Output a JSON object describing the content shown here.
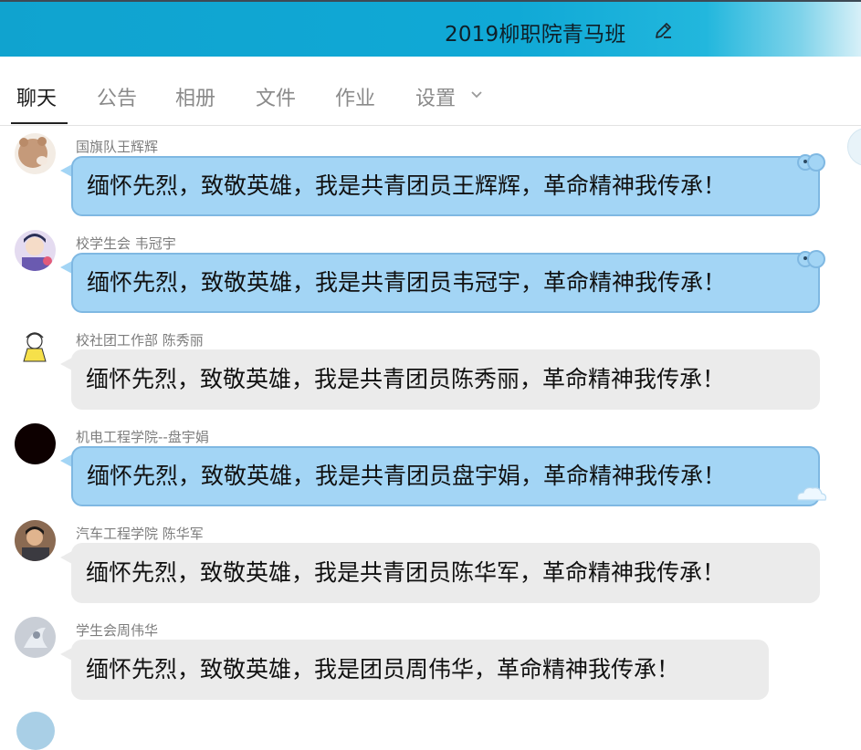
{
  "header": {
    "title": "2019柳职院青马班",
    "edit_icon": "edit-pencil-icon"
  },
  "tabs": [
    {
      "label": "聊天",
      "active": true
    },
    {
      "label": "公告"
    },
    {
      "label": "相册"
    },
    {
      "label": "文件"
    },
    {
      "label": "作业"
    },
    {
      "label": "设置"
    }
  ],
  "colors": {
    "header_bg": "#10a9d6",
    "bubble_blue": "#a3d5f5",
    "bubble_blue_border": "#7fb8e2",
    "bubble_gray": "#ebebeb"
  },
  "messages": [
    {
      "sender": "国旗队王辉辉",
      "text": "缅怀先烈，致敬英雄，我是共青团员王辉辉，革命精神我传承！",
      "style": "blue"
    },
    {
      "sender": "校学生会 韦冠宇",
      "text": "缅怀先烈，致敬英雄，我是共青团员韦冠宇，革命精神我传承！",
      "style": "blue"
    },
    {
      "sender": "校社团工作部 陈秀丽",
      "text": "缅怀先烈，致敬英雄，我是共青团员陈秀丽，革命精神我传承！",
      "style": "gray"
    },
    {
      "sender": "机电工程学院--盘宇娟",
      "text": "缅怀先烈，致敬英雄，我是共青团员盘宇娟，革命精神我传承！",
      "style": "blue"
    },
    {
      "sender": "汽车工程学院  陈华军",
      "text": "缅怀先烈，致敬英雄，我是共青团员陈华军，革命精神我传承！",
      "style": "gray"
    },
    {
      "sender": "学生会周伟华",
      "text": "缅怀先烈，致敬英雄，我是团员周伟华，革命精神我传承！",
      "style": "gray"
    }
  ]
}
